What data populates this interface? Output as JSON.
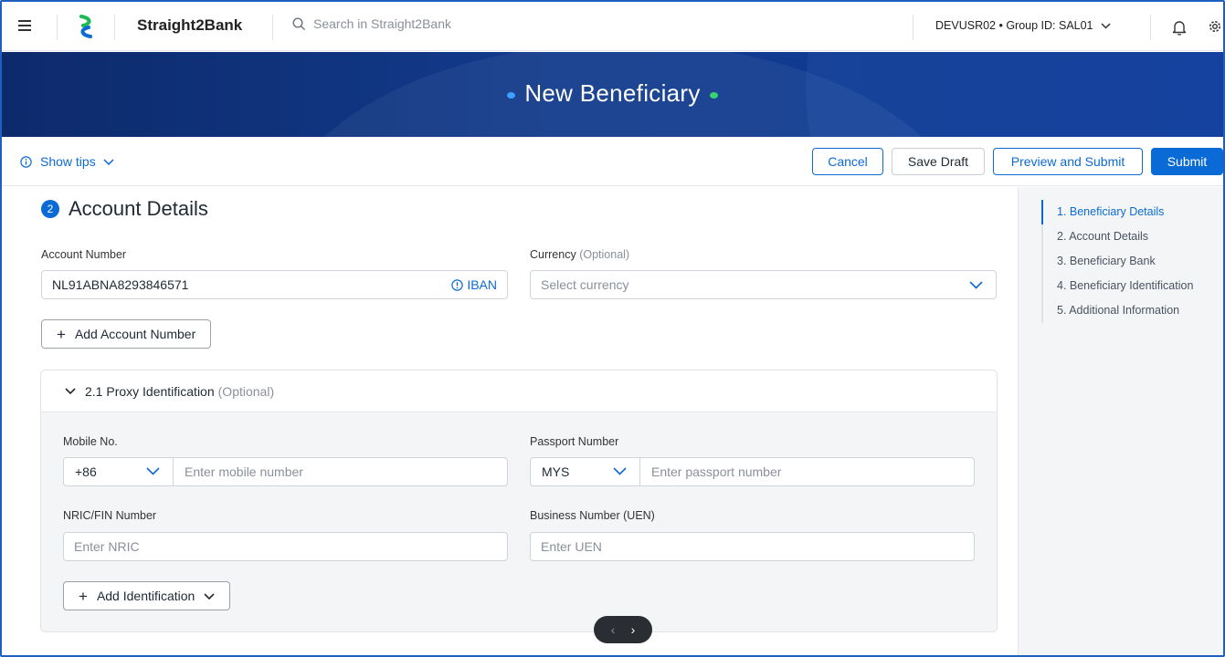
{
  "header": {
    "brand": "Straight2Bank",
    "search_placeholder": "Search in Straight2Bank",
    "user_label": "DEVUSR02 • Group ID: SAL01"
  },
  "banner": {
    "title": "New Beneficiary"
  },
  "actions": {
    "tips_label": "Show tips",
    "cancel": "Cancel",
    "save_draft": "Save Draft",
    "preview_submit": "Preview and Submit",
    "submit": "Submit"
  },
  "section": {
    "number": "2",
    "title": "Account Details",
    "account_number_label": "Account Number",
    "account_number_value": "NL91ABNA8293846571",
    "iban_label": "IBAN",
    "currency_label": "Currency",
    "currency_optional": "(Optional)",
    "currency_placeholder": "Select currency",
    "add_account_label": "Add Account Number"
  },
  "proxy": {
    "title": "2.1 Proxy Identification",
    "optional": "(Optional)",
    "mobile_label": "Mobile No.",
    "dial_code": "+86",
    "mobile_placeholder": "Enter mobile number",
    "passport_label": "Passport Number",
    "passport_country": "MYS",
    "passport_placeholder": "Enter passport number",
    "nric_label": "NRIC/FIN Number",
    "nric_placeholder": "Enter NRIC",
    "uen_label": "Business Number (UEN)",
    "uen_placeholder": "Enter UEN",
    "add_identification_label": "Add Identification"
  },
  "stepper": {
    "steps": [
      "1. Beneficiary Details",
      "2. Account Details",
      "3. Beneficiary Bank",
      "4. Beneficiary Identification",
      "5. Additional Information"
    ]
  },
  "scroller": {
    "prev": "‹",
    "next": "›"
  },
  "colors": {
    "accent": "#0b6bd6",
    "banner": "#123b8c",
    "panel_bg": "#f4f5f7"
  }
}
